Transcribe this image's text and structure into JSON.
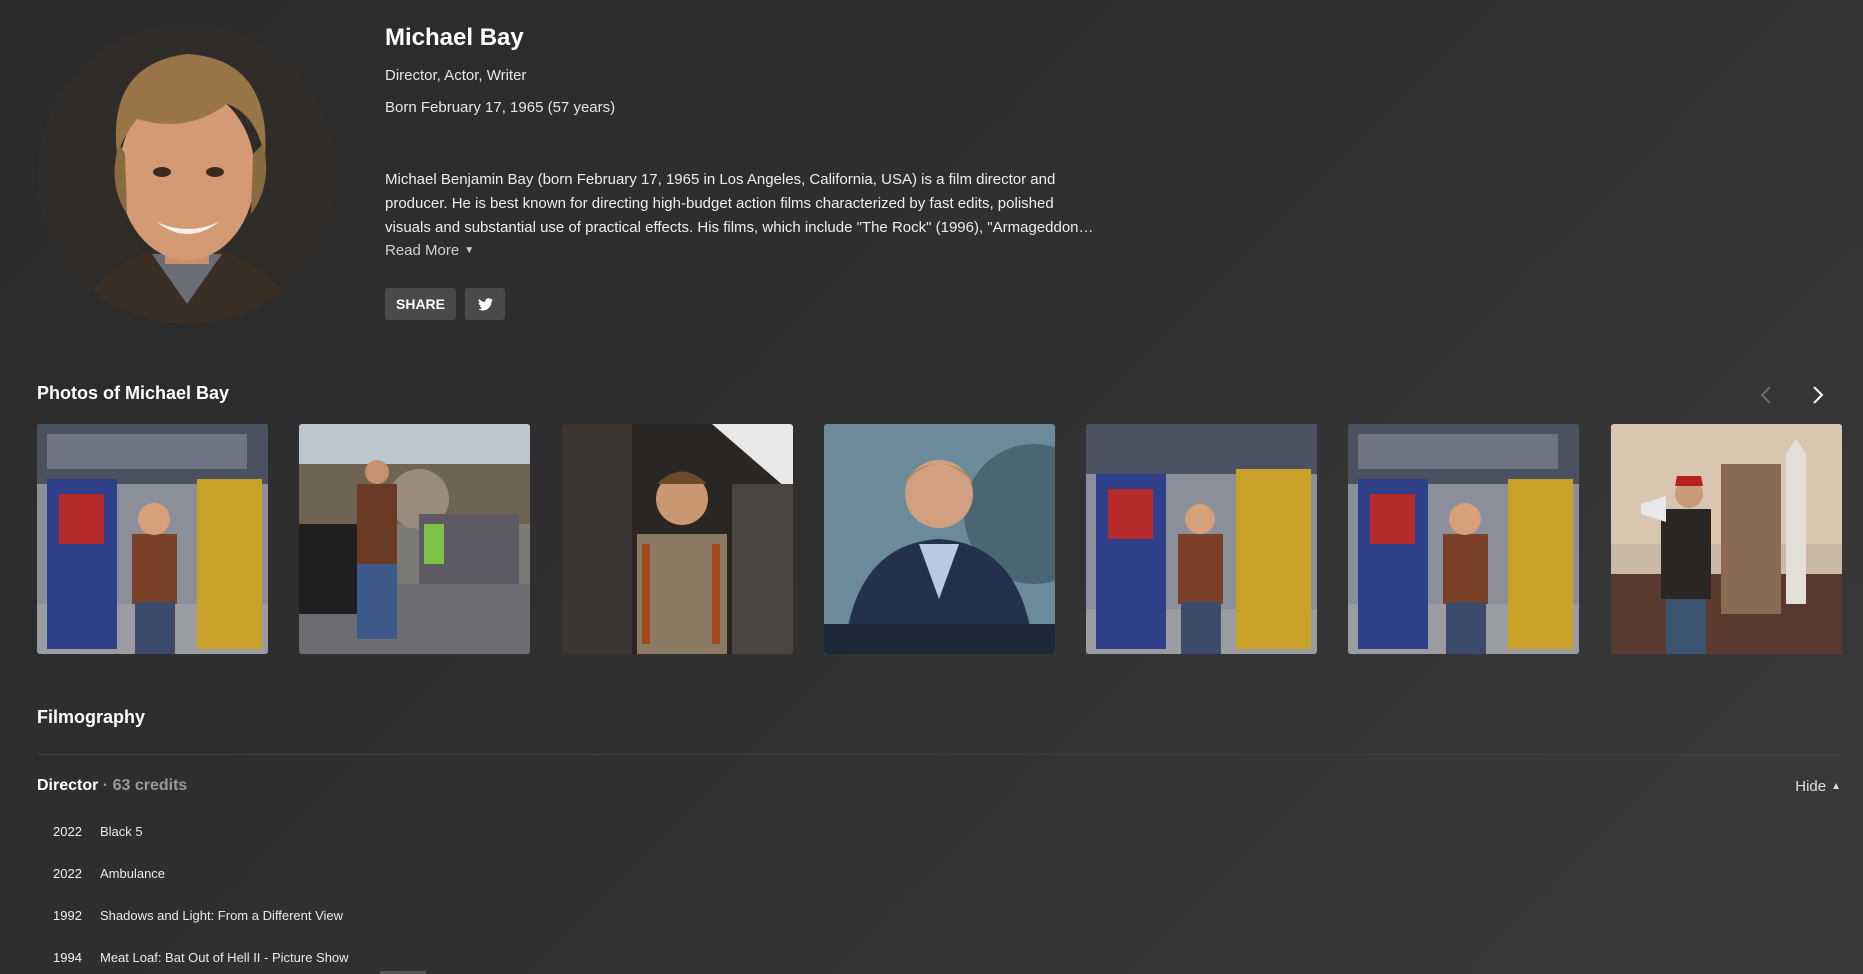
{
  "person": {
    "name": "Michael Bay",
    "roles": "Director, Actor, Writer",
    "born": "Born February 17, 1965 (57 years)",
    "bio": "Michael Benjamin Bay (born February 17, 1965 in Los Angeles, California, USA) is a film director and producer. He is best known for directing high-budget action films characterized by fast edits, polished visuals and substantial use of practical effects. His films, which include \"The Rock\" (1996), \"Armageddon…",
    "read_more": "Read More"
  },
  "actions": {
    "share_label": "SHARE",
    "twitter_icon": "twitter-icon"
  },
  "photos": {
    "title": "Photos of Michael Bay",
    "items": [
      {
        "scene": "transformers-ride"
      },
      {
        "scene": "crowd-walk"
      },
      {
        "scene": "cockpit"
      },
      {
        "scene": "stage-talk"
      },
      {
        "scene": "transformers-ride"
      },
      {
        "scene": "transformers-ride"
      },
      {
        "scene": "megaphone-shuttle"
      }
    ]
  },
  "filmography": {
    "title": "Filmography",
    "section": "Director",
    "count": " · 63 credits",
    "hide_label": "Hide",
    "credits": [
      {
        "year": "2022",
        "title": "Black 5"
      },
      {
        "year": "2022",
        "title": "Ambulance"
      },
      {
        "year": "1992",
        "title": "Shadows and Light: From a Different View"
      },
      {
        "year": "1994",
        "title": "Meat Loaf: Bat Out of Hell II - Picture Show"
      }
    ]
  },
  "colors": {
    "background": "#2e2e2e",
    "button": "#4a4a4a",
    "muted": "#9a9a9a"
  }
}
